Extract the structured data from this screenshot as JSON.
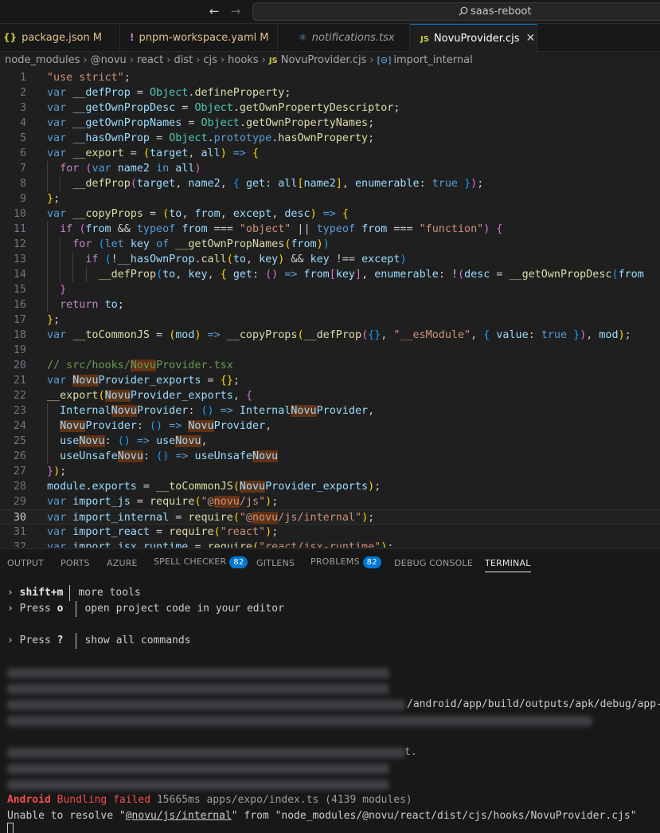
{
  "search": {
    "text": "saas-reboot"
  },
  "tabs": [
    {
      "icon": "{}",
      "name": "package.json",
      "modified": "M"
    },
    {
      "icon": "!",
      "name": "pnpm-workspace.yaml",
      "modified": "M"
    },
    {
      "icon": "⚛",
      "name": "notifications.tsx"
    },
    {
      "icon": "JS",
      "name": "NovuProvider.cjs",
      "close": "✕"
    }
  ],
  "breadcrumb": [
    "node_modules",
    "@novu",
    "react",
    "dist",
    "cjs",
    "hooks",
    "NovuProvider.cjs",
    "import_internal"
  ],
  "editor": {
    "current_line": 30,
    "line_numbers": [
      "1",
      "2",
      "3",
      "4",
      "5",
      "6",
      "7",
      "8",
      "9",
      "10",
      "11",
      "12",
      "13",
      "14",
      "15",
      "16",
      "17",
      "18",
      "19",
      "20",
      "21",
      "22",
      "23",
      "24",
      "25",
      "26",
      "27",
      "28",
      "29",
      "30",
      "31",
      "32"
    ]
  },
  "panel": {
    "tabs": [
      {
        "label": "OUTPUT"
      },
      {
        "label": "PORTS"
      },
      {
        "label": "AZURE"
      },
      {
        "label": "SPELL CHECKER",
        "badge": "82"
      },
      {
        "label": "GITLENS"
      },
      {
        "label": "PROBLEMS",
        "badge": "82"
      },
      {
        "label": "DEBUG CONSOLE"
      },
      {
        "label": "TERMINAL",
        "active": true
      }
    ]
  },
  "terminal": {
    "menu": [
      {
        "prefix": "› ",
        "key": "shift+m",
        "desc": "more tools"
      },
      {
        "prefix": "› Press ",
        "key": "o",
        "desc": "open project code in your editor"
      },
      {
        "prefix": "› Press ",
        "key": "?",
        "desc": "show all commands"
      }
    ],
    "partial_path": "/android/app/build/outputs/apk/debug/app-",
    "partial_exit": "t.",
    "error_platform": "Android",
    "error_status": "Bundling failed",
    "error_detail": " 15665ms apps/expo/index.ts (4139 modules)",
    "resolve_pre": "Unable to resolve \"",
    "resolve_module": "@novu/js/internal",
    "resolve_post": "\" from \"node_modules/@novu/react/dist/cjs/hooks/NovuProvider.cjs\""
  }
}
